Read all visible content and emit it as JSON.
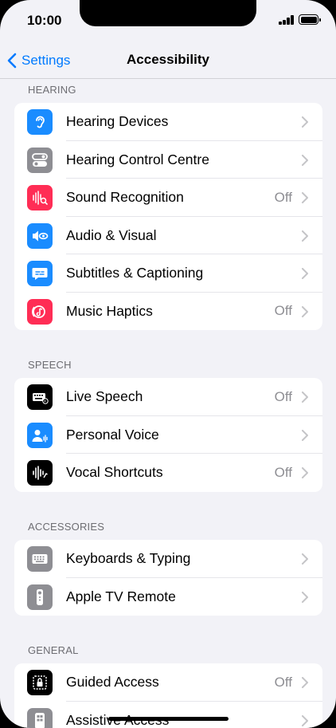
{
  "status": {
    "time": "10:00"
  },
  "nav": {
    "back_label": "Settings",
    "title": "Accessibility"
  },
  "sections": [
    {
      "header": "HEARING",
      "rows": [
        {
          "label": "Hearing Devices",
          "value": "",
          "icon": "ear-icon",
          "color": "#1a8cff"
        },
        {
          "label": "Hearing Control Centre",
          "value": "",
          "icon": "toggles-icon",
          "color": "#8e8e93"
        },
        {
          "label": "Sound Recognition",
          "value": "Off",
          "icon": "waveform-magnifier-icon",
          "color": "#ff2d55"
        },
        {
          "label": "Audio & Visual",
          "value": "",
          "icon": "speaker-eye-icon",
          "color": "#1a8cff"
        },
        {
          "label": "Subtitles & Captioning",
          "value": "",
          "icon": "caption-bubble-icon",
          "color": "#1a8cff"
        },
        {
          "label": "Music Haptics",
          "value": "Off",
          "icon": "music-haptics-icon",
          "color": "#ff2d55"
        }
      ]
    },
    {
      "header": "SPEECH",
      "rows": [
        {
          "label": "Live Speech",
          "value": "Off",
          "icon": "keyboard-speech-icon",
          "color": "#000000"
        },
        {
          "label": "Personal Voice",
          "value": "",
          "icon": "person-wave-icon",
          "color": "#1a8cff"
        },
        {
          "label": "Vocal Shortcuts",
          "value": "Off",
          "icon": "waveform-arrow-icon",
          "color": "#000000"
        }
      ]
    },
    {
      "header": "ACCESSORIES",
      "rows": [
        {
          "label": "Keyboards & Typing",
          "value": "",
          "icon": "keyboard-icon",
          "color": "#8e8e93"
        },
        {
          "label": "Apple TV Remote",
          "value": "",
          "icon": "remote-icon",
          "color": "#8e8e93"
        }
      ]
    },
    {
      "header": "GENERAL",
      "rows": [
        {
          "label": "Guided Access",
          "value": "Off",
          "icon": "lock-frame-icon",
          "color": "#000000"
        },
        {
          "label": "Assistive Access",
          "value": "",
          "icon": "assistive-grid-icon",
          "color": "#8e8e93"
        }
      ]
    }
  ]
}
